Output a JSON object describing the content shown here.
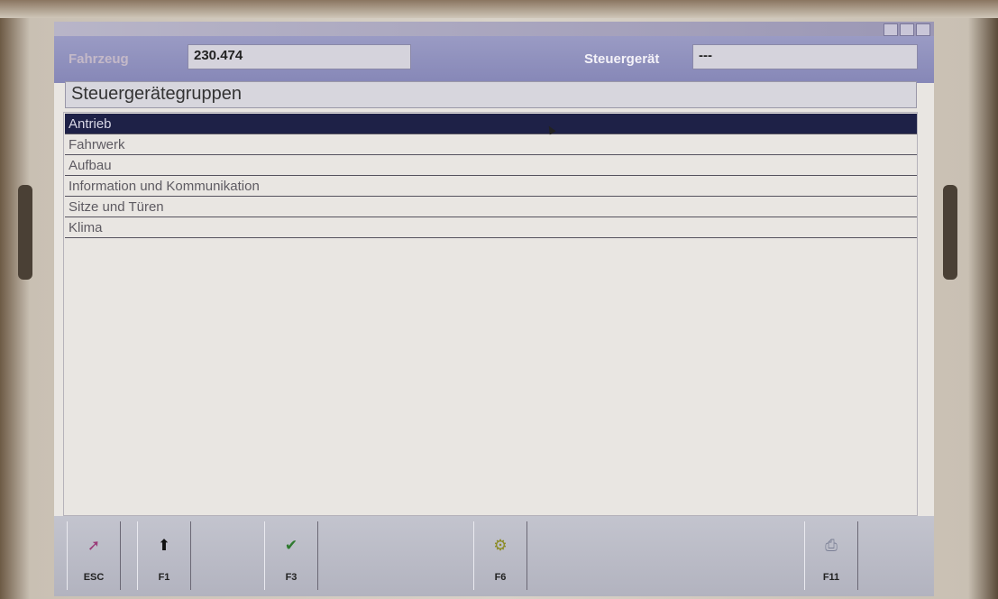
{
  "header": {
    "vehicle_label": "Fahrzeug",
    "vehicle_value": "230.474",
    "ecu_label": "Steuergerät",
    "ecu_value": "---"
  },
  "group_title": "Steuergerätegruppen",
  "groups": [
    {
      "label": "Antrieb",
      "selected": true
    },
    {
      "label": "Fahrwerk",
      "selected": false
    },
    {
      "label": "Aufbau",
      "selected": false
    },
    {
      "label": "Information und Kommunikation",
      "selected": false
    },
    {
      "label": "Sitze und Türen",
      "selected": false
    },
    {
      "label": "Klima",
      "selected": false
    }
  ],
  "function_keys": [
    {
      "label": "ESC",
      "icon": "exit-icon",
      "color": "#9b3a78"
    },
    {
      "label": "F1",
      "icon": "arrow-up-icon",
      "color": "#111111"
    },
    {
      "label": "F3",
      "icon": "checkmark-icon",
      "color": "#2f7a2f"
    },
    {
      "label": "F6",
      "icon": "tools-icon",
      "color": "#8a8a20"
    },
    {
      "label": "F11",
      "icon": "printer-icon",
      "color": "#7a7f95"
    }
  ],
  "colors": {
    "header": "#8d8ebb",
    "selection": "#1e2147"
  }
}
